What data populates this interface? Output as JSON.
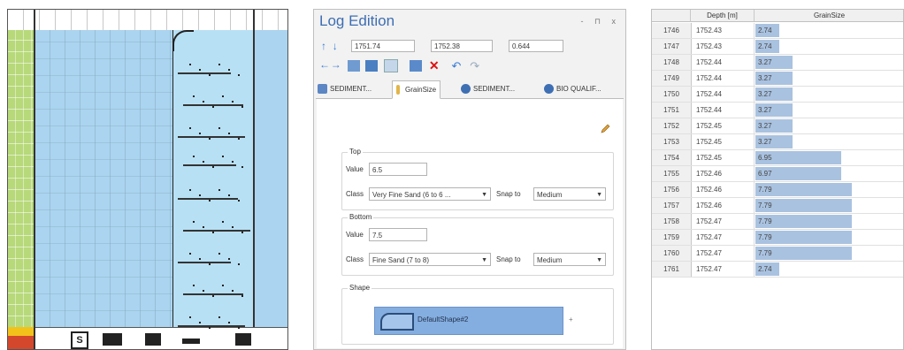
{
  "track_panel": {
    "footer_symbol": "S"
  },
  "log_edition": {
    "title": "Log Edition",
    "window_buttons": "- ⊓ x",
    "top_depth": "1751.74",
    "bottom_depth": "1752.38",
    "thickness": "0.644",
    "tabs": [
      {
        "label": "SEDIMENT...",
        "icon": "sediment-icon"
      },
      {
        "label": "GrainSize",
        "icon": "grainsize-icon"
      },
      {
        "label": "SEDIMENT...",
        "icon": "sediment-icon"
      },
      {
        "label": "BIO QUALIF...",
        "icon": "bio-icon"
      }
    ],
    "top_group": {
      "title": "Top",
      "value_label": "Value",
      "value": "6.5",
      "class_label": "Class",
      "class_value": "Very Fine Sand (6 to 6 ...",
      "snap_label": "Snap to",
      "snap_value": "Medium"
    },
    "bottom_group": {
      "title": "Bottom",
      "value_label": "Value",
      "value": "7.5",
      "class_label": "Class",
      "class_value": "Fine Sand (7 to 8)",
      "snap_label": "Snap to",
      "snap_value": "Medium"
    },
    "shape_group": {
      "title": "Shape",
      "shape_name": "DefaultShape#2",
      "more": "+"
    }
  },
  "table": {
    "headers": [
      "",
      "Depth [m]",
      "GrainSize"
    ],
    "rows": [
      {
        "id": "1746",
        "depth": "1752.43",
        "grain": "2.74",
        "fill": 0.16
      },
      {
        "id": "1747",
        "depth": "1752.43",
        "grain": "2.74",
        "fill": 0.16
      },
      {
        "id": "1748",
        "depth": "1752.44",
        "grain": "3.27",
        "fill": 0.25
      },
      {
        "id": "1749",
        "depth": "1752.44",
        "grain": "3.27",
        "fill": 0.25
      },
      {
        "id": "1750",
        "depth": "1752.44",
        "grain": "3.27",
        "fill": 0.25
      },
      {
        "id": "1751",
        "depth": "1752.44",
        "grain": "3.27",
        "fill": 0.25
      },
      {
        "id": "1752",
        "depth": "1752.45",
        "grain": "3.27",
        "fill": 0.25
      },
      {
        "id": "1753",
        "depth": "1752.45",
        "grain": "3.27",
        "fill": 0.25
      },
      {
        "id": "1754",
        "depth": "1752.45",
        "grain": "6.95",
        "fill": 0.58
      },
      {
        "id": "1755",
        "depth": "1752.46",
        "grain": "6.97",
        "fill": 0.58
      },
      {
        "id": "1756",
        "depth": "1752.46",
        "grain": "7.79",
        "fill": 0.65
      },
      {
        "id": "1757",
        "depth": "1752.46",
        "grain": "7.79",
        "fill": 0.65
      },
      {
        "id": "1758",
        "depth": "1752.47",
        "grain": "7.79",
        "fill": 0.65
      },
      {
        "id": "1759",
        "depth": "1752.47",
        "grain": "7.79",
        "fill": 0.65
      },
      {
        "id": "1760",
        "depth": "1752.47",
        "grain": "7.79",
        "fill": 0.65
      },
      {
        "id": "1761",
        "depth": "1752.47",
        "grain": "2.74",
        "fill": 0.16
      }
    ]
  },
  "colors": {
    "title_blue": "#3d6db3",
    "track_blue": "#aad4ef",
    "track_green": "#b7d97a",
    "bar_blue": "#a9c2e0",
    "shape_blue": "#85aee0"
  }
}
